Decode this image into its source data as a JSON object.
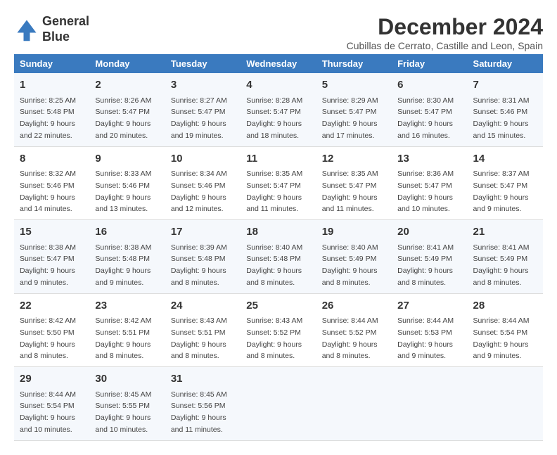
{
  "header": {
    "logo_line1": "General",
    "logo_line2": "Blue",
    "month_title": "December 2024",
    "subtitle": "Cubillas de Cerrato, Castille and Leon, Spain"
  },
  "weekdays": [
    "Sunday",
    "Monday",
    "Tuesday",
    "Wednesday",
    "Thursday",
    "Friday",
    "Saturday"
  ],
  "weeks": [
    [
      {
        "day": "1",
        "sunrise": "8:25 AM",
        "sunset": "5:48 PM",
        "daylight": "9 hours and 22 minutes."
      },
      {
        "day": "2",
        "sunrise": "8:26 AM",
        "sunset": "5:47 PM",
        "daylight": "9 hours and 20 minutes."
      },
      {
        "day": "3",
        "sunrise": "8:27 AM",
        "sunset": "5:47 PM",
        "daylight": "9 hours and 19 minutes."
      },
      {
        "day": "4",
        "sunrise": "8:28 AM",
        "sunset": "5:47 PM",
        "daylight": "9 hours and 18 minutes."
      },
      {
        "day": "5",
        "sunrise": "8:29 AM",
        "sunset": "5:47 PM",
        "daylight": "9 hours and 17 minutes."
      },
      {
        "day": "6",
        "sunrise": "8:30 AM",
        "sunset": "5:47 PM",
        "daylight": "9 hours and 16 minutes."
      },
      {
        "day": "7",
        "sunrise": "8:31 AM",
        "sunset": "5:46 PM",
        "daylight": "9 hours and 15 minutes."
      }
    ],
    [
      {
        "day": "8",
        "sunrise": "8:32 AM",
        "sunset": "5:46 PM",
        "daylight": "9 hours and 14 minutes."
      },
      {
        "day": "9",
        "sunrise": "8:33 AM",
        "sunset": "5:46 PM",
        "daylight": "9 hours and 13 minutes."
      },
      {
        "day": "10",
        "sunrise": "8:34 AM",
        "sunset": "5:46 PM",
        "daylight": "9 hours and 12 minutes."
      },
      {
        "day": "11",
        "sunrise": "8:35 AM",
        "sunset": "5:47 PM",
        "daylight": "9 hours and 11 minutes."
      },
      {
        "day": "12",
        "sunrise": "8:35 AM",
        "sunset": "5:47 PM",
        "daylight": "9 hours and 11 minutes."
      },
      {
        "day": "13",
        "sunrise": "8:36 AM",
        "sunset": "5:47 PM",
        "daylight": "9 hours and 10 minutes."
      },
      {
        "day": "14",
        "sunrise": "8:37 AM",
        "sunset": "5:47 PM",
        "daylight": "9 hours and 9 minutes."
      }
    ],
    [
      {
        "day": "15",
        "sunrise": "8:38 AM",
        "sunset": "5:47 PM",
        "daylight": "9 hours and 9 minutes."
      },
      {
        "day": "16",
        "sunrise": "8:38 AM",
        "sunset": "5:48 PM",
        "daylight": "9 hours and 9 minutes."
      },
      {
        "day": "17",
        "sunrise": "8:39 AM",
        "sunset": "5:48 PM",
        "daylight": "9 hours and 8 minutes."
      },
      {
        "day": "18",
        "sunrise": "8:40 AM",
        "sunset": "5:48 PM",
        "daylight": "9 hours and 8 minutes."
      },
      {
        "day": "19",
        "sunrise": "8:40 AM",
        "sunset": "5:49 PM",
        "daylight": "9 hours and 8 minutes."
      },
      {
        "day": "20",
        "sunrise": "8:41 AM",
        "sunset": "5:49 PM",
        "daylight": "9 hours and 8 minutes."
      },
      {
        "day": "21",
        "sunrise": "8:41 AM",
        "sunset": "5:49 PM",
        "daylight": "9 hours and 8 minutes."
      }
    ],
    [
      {
        "day": "22",
        "sunrise": "8:42 AM",
        "sunset": "5:50 PM",
        "daylight": "9 hours and 8 minutes."
      },
      {
        "day": "23",
        "sunrise": "8:42 AM",
        "sunset": "5:51 PM",
        "daylight": "9 hours and 8 minutes."
      },
      {
        "day": "24",
        "sunrise": "8:43 AM",
        "sunset": "5:51 PM",
        "daylight": "9 hours and 8 minutes."
      },
      {
        "day": "25",
        "sunrise": "8:43 AM",
        "sunset": "5:52 PM",
        "daylight": "9 hours and 8 minutes."
      },
      {
        "day": "26",
        "sunrise": "8:44 AM",
        "sunset": "5:52 PM",
        "daylight": "9 hours and 8 minutes."
      },
      {
        "day": "27",
        "sunrise": "8:44 AM",
        "sunset": "5:53 PM",
        "daylight": "9 hours and 9 minutes."
      },
      {
        "day": "28",
        "sunrise": "8:44 AM",
        "sunset": "5:54 PM",
        "daylight": "9 hours and 9 minutes."
      }
    ],
    [
      {
        "day": "29",
        "sunrise": "8:44 AM",
        "sunset": "5:54 PM",
        "daylight": "9 hours and 10 minutes."
      },
      {
        "day": "30",
        "sunrise": "8:45 AM",
        "sunset": "5:55 PM",
        "daylight": "9 hours and 10 minutes."
      },
      {
        "day": "31",
        "sunrise": "8:45 AM",
        "sunset": "5:56 PM",
        "daylight": "9 hours and 11 minutes."
      },
      null,
      null,
      null,
      null
    ]
  ]
}
